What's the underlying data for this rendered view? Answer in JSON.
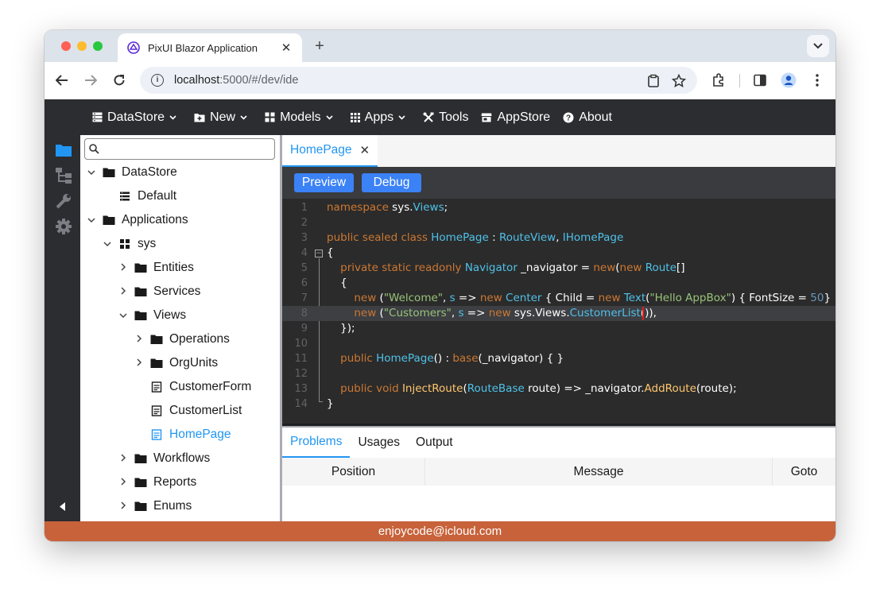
{
  "browser": {
    "tab_title": "PixUI Blazor Application",
    "tab_close": "✕",
    "new_tab": "+",
    "url_host": "localhost",
    "url_path": ":5000/#/dev/ide"
  },
  "menu": {
    "items": [
      {
        "label": "DataStore",
        "icon": "datastore-icon",
        "dropdown": true
      },
      {
        "label": "New",
        "icon": "folder-plus-icon",
        "dropdown": true
      },
      {
        "label": "Models",
        "icon": "models-icon",
        "dropdown": true
      },
      {
        "label": "Apps",
        "icon": "grid-icon",
        "dropdown": true
      },
      {
        "label": "Tools",
        "icon": "tools-icon",
        "dropdown": false
      },
      {
        "label": "AppStore",
        "icon": "store-icon",
        "dropdown": false
      },
      {
        "label": "About",
        "icon": "help-icon",
        "dropdown": false
      }
    ]
  },
  "tree": {
    "search_placeholder": "",
    "nodes": [
      {
        "label": "DataStore",
        "chevron": "expanded",
        "icon": "folder"
      },
      {
        "label": "Default",
        "chevron": "none",
        "icon": "list"
      },
      {
        "label": "Applications",
        "chevron": "expanded",
        "icon": "folder"
      },
      {
        "label": "sys",
        "chevron": "expanded",
        "icon": "app"
      },
      {
        "label": "Entities",
        "chevron": "collapsed",
        "icon": "folder"
      },
      {
        "label": "Services",
        "chevron": "collapsed",
        "icon": "folder"
      },
      {
        "label": "Views",
        "chevron": "expanded",
        "icon": "folder"
      },
      {
        "label": "Operations",
        "chevron": "collapsed",
        "icon": "folder"
      },
      {
        "label": "OrgUnits",
        "chevron": "collapsed",
        "icon": "folder"
      },
      {
        "label": "CustomerForm",
        "chevron": "none",
        "icon": "view"
      },
      {
        "label": "CustomerList",
        "chevron": "none",
        "icon": "view"
      },
      {
        "label": "HomePage",
        "chevron": "none",
        "icon": "view",
        "selected": true
      },
      {
        "label": "Workflows",
        "chevron": "collapsed",
        "icon": "folder"
      },
      {
        "label": "Reports",
        "chevron": "collapsed",
        "icon": "folder"
      },
      {
        "label": "Enums",
        "chevron": "collapsed",
        "icon": "folder"
      }
    ]
  },
  "editor": {
    "tab_label": "HomePage",
    "tab_close": "✕",
    "preview_label": "Preview",
    "debug_label": "Debug",
    "line_numbers": [
      "1",
      "2",
      "3",
      "4",
      "5",
      "6",
      "7",
      "8",
      "9",
      "10",
      "11",
      "12",
      "13",
      "14"
    ],
    "highlighted_line": 8
  },
  "bottom": {
    "tabs": [
      "Problems",
      "Usages",
      "Output"
    ],
    "active_tab": "Problems",
    "columns": [
      "Position",
      "Message",
      "Goto"
    ]
  },
  "status": {
    "text": "enjoycode@icloud.com"
  },
  "colors": {
    "accent": "#2196f3",
    "button": "#3b82f6",
    "status_bar": "#c7623a",
    "menubar": "#2b2d30",
    "editor_bg": "#2b2b2b"
  }
}
